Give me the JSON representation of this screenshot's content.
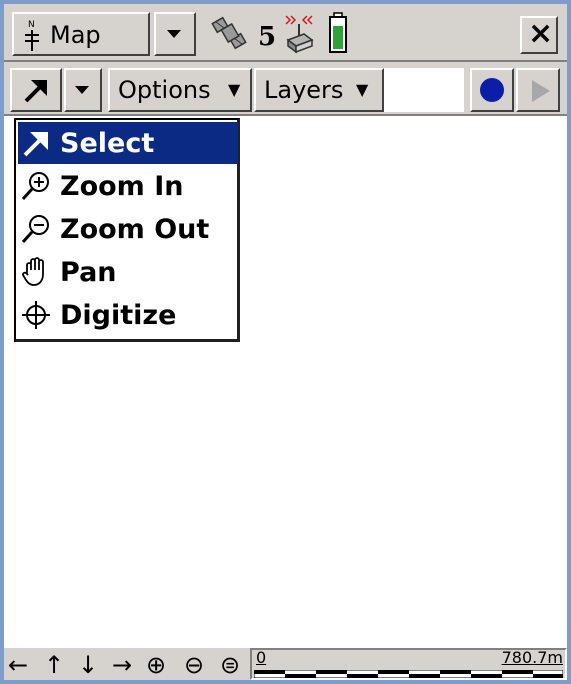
{
  "titlebar": {
    "app_label": "Map",
    "satellite_count": "5",
    "close_glyph": "×"
  },
  "toolbar": {
    "options_label": "Options",
    "layers_label": "Layers",
    "dropdown_glyph": "▼",
    "record_color": "#0a1ea8"
  },
  "tool_menu": {
    "items": [
      {
        "label": "Select",
        "icon": "arrow-icon",
        "selected": true
      },
      {
        "label": "Zoom In",
        "icon": "zoom-in-icon",
        "selected": false
      },
      {
        "label": "Zoom Out",
        "icon": "zoom-out-icon",
        "selected": false
      },
      {
        "label": "Pan",
        "icon": "hand-icon",
        "selected": false
      },
      {
        "label": "Digitize",
        "icon": "crosshair-icon",
        "selected": false
      }
    ],
    "selected_color": "#0a2a84"
  },
  "bottombar": {
    "nav": [
      "←",
      "↑",
      "↓",
      "→",
      "⊕",
      "⊖",
      "⊜"
    ],
    "scale_start": "0",
    "scale_end": "780.7m"
  }
}
